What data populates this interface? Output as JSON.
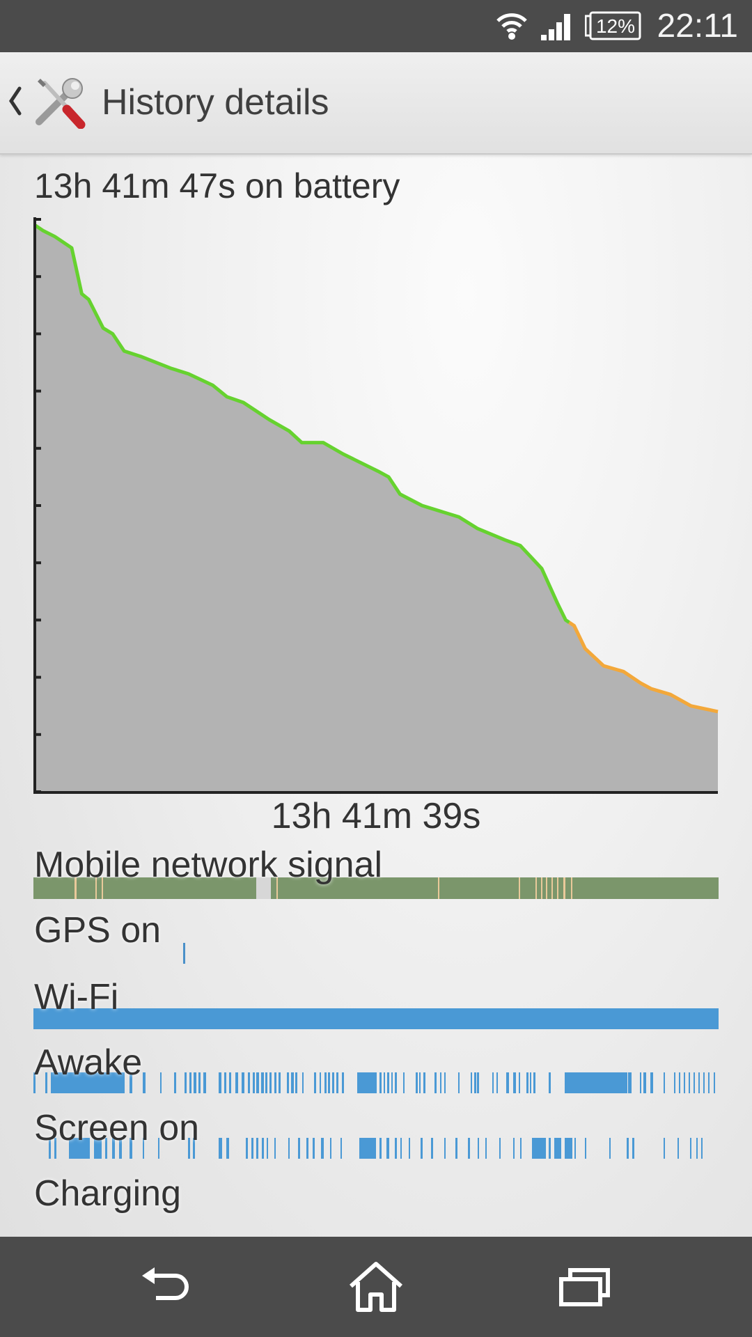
{
  "status_bar": {
    "battery_percent": "12%",
    "time": "22:11"
  },
  "header": {
    "title": "History details"
  },
  "summary": {
    "on_battery": "13h 41m 47s on battery",
    "x_axis_label": "13h 41m 39s"
  },
  "chart_data": {
    "type": "area",
    "title": "",
    "xlabel": "13h 41m 39s",
    "ylabel": "",
    "x_range_hours": [
      0,
      13.69
    ],
    "y_range_percent": [
      0,
      100
    ],
    "series": [
      {
        "x_hours": [
          0,
          0.17,
          0.4,
          0.74,
          0.94,
          1.08,
          1.37,
          1.56,
          1.79,
          2.14,
          2.72,
          3.08,
          3.57,
          3.85,
          4.18,
          4.7,
          5.1,
          5.35,
          5.78,
          6.18,
          6.88,
          7.09,
          7.32,
          7.76,
          8.5,
          8.87,
          9.42,
          9.73,
          10.16,
          10.47,
          10.64,
          10.81,
          11.03,
          11.4,
          11.8,
          12.14,
          12.35,
          12.74,
          13.15,
          13.69
        ],
        "level_percent": [
          99,
          98,
          97,
          95,
          87,
          86,
          81,
          80,
          77,
          76,
          74,
          73,
          71,
          69,
          68,
          65,
          63,
          61,
          61,
          59,
          56,
          55,
          52,
          50,
          48,
          46,
          44,
          43,
          39,
          33,
          30,
          29,
          25,
          22,
          21,
          19,
          18,
          17,
          15,
          14
        ],
        "line_color_segments": [
          {
            "to_hours": 10.71,
            "color": "#66d22f"
          },
          {
            "to_hours": 13.69,
            "color": "#f3a83a"
          }
        ]
      }
    ],
    "fill_color": "#b3b3b3",
    "grid": false
  },
  "rows": [
    {
      "label": "Mobile network signal",
      "key": "signal"
    },
    {
      "label": "GPS on",
      "key": "gps"
    },
    {
      "label": "Wi-Fi",
      "key": "wifi"
    },
    {
      "label": "Awake",
      "key": "awake"
    },
    {
      "label": "Screen on",
      "key": "screen"
    },
    {
      "label": "Charging",
      "key": "charging"
    }
  ],
  "bars": {
    "signal": {
      "color": "#7b966b",
      "gaps": [
        [
          0.06,
          0.003
        ],
        [
          0.09,
          0.003
        ],
        [
          0.1,
          0.002
        ],
        [
          0.325,
          0.022
        ],
        [
          0.355,
          0.002
        ],
        [
          0.59,
          0.002
        ],
        [
          0.708,
          0.002
        ],
        [
          0.733,
          0.002
        ],
        [
          0.741,
          0.002
        ],
        [
          0.748,
          0.002
        ],
        [
          0.756,
          0.002
        ],
        [
          0.764,
          0.002
        ],
        [
          0.773,
          0.003
        ],
        [
          0.785,
          0.002
        ]
      ],
      "gap_colors": [
        "#e9c99a",
        "#d7d7d7"
      ]
    },
    "gps": {
      "color": "#4a90c9",
      "spans": [
        [
          0.219,
          0.003
        ]
      ]
    },
    "wifi": {
      "color": "#4a99d5",
      "spans": [
        [
          0,
          1
        ]
      ]
    },
    "awake": {
      "color": "#4a99d5",
      "spans": [
        [
          0.0,
          0.003
        ],
        [
          0.017,
          0.003
        ],
        [
          0.025,
          0.108
        ],
        [
          0.14,
          0.004
        ],
        [
          0.16,
          0.004
        ],
        [
          0.185,
          0.002
        ],
        [
          0.205,
          0.003
        ],
        [
          0.221,
          0.003
        ],
        [
          0.228,
          0.003
        ],
        [
          0.234,
          0.004
        ],
        [
          0.241,
          0.003
        ],
        [
          0.248,
          0.004
        ],
        [
          0.27,
          0.004
        ],
        [
          0.278,
          0.004
        ],
        [
          0.286,
          0.003
        ],
        [
          0.295,
          0.004
        ],
        [
          0.304,
          0.004
        ],
        [
          0.313,
          0.003
        ],
        [
          0.32,
          0.003
        ],
        [
          0.325,
          0.004
        ],
        [
          0.332,
          0.004
        ],
        [
          0.338,
          0.003
        ],
        [
          0.345,
          0.003
        ],
        [
          0.352,
          0.003
        ],
        [
          0.358,
          0.003
        ],
        [
          0.37,
          0.003
        ],
        [
          0.376,
          0.004
        ],
        [
          0.382,
          0.003
        ],
        [
          0.392,
          0.002
        ],
        [
          0.41,
          0.003
        ],
        [
          0.418,
          0.002
        ],
        [
          0.425,
          0.003
        ],
        [
          0.43,
          0.003
        ],
        [
          0.436,
          0.003
        ],
        [
          0.442,
          0.003
        ],
        [
          0.45,
          0.003
        ],
        [
          0.473,
          0.028
        ],
        [
          0.505,
          0.003
        ],
        [
          0.511,
          0.002
        ],
        [
          0.516,
          0.003
        ],
        [
          0.522,
          0.002
        ],
        [
          0.527,
          0.003
        ],
        [
          0.54,
          0.002
        ],
        [
          0.558,
          0.003
        ],
        [
          0.563,
          0.002
        ],
        [
          0.569,
          0.003
        ],
        [
          0.585,
          0.003
        ],
        [
          0.593,
          0.003
        ],
        [
          0.6,
          0.002
        ],
        [
          0.62,
          0.002
        ],
        [
          0.638,
          0.002
        ],
        [
          0.643,
          0.003
        ],
        [
          0.647,
          0.003
        ],
        [
          0.67,
          0.002
        ],
        [
          0.676,
          0.002
        ],
        [
          0.69,
          0.004
        ],
        [
          0.7,
          0.004
        ],
        [
          0.708,
          0.002
        ],
        [
          0.72,
          0.003
        ],
        [
          0.725,
          0.002
        ],
        [
          0.73,
          0.003
        ],
        [
          0.752,
          0.003
        ],
        [
          0.775,
          0.092
        ],
        [
          0.87,
          0.003
        ],
        [
          0.868,
          0.002
        ],
        [
          0.885,
          0.002
        ],
        [
          0.89,
          0.004
        ],
        [
          0.9,
          0.004
        ],
        [
          0.92,
          0.002
        ],
        [
          0.935,
          0.002
        ],
        [
          0.942,
          0.002
        ],
        [
          0.949,
          0.002
        ],
        [
          0.956,
          0.002
        ],
        [
          0.963,
          0.002
        ],
        [
          0.971,
          0.002
        ],
        [
          0.978,
          0.002
        ],
        [
          0.985,
          0.002
        ],
        [
          0.993,
          0.002
        ]
      ]
    },
    "screen": {
      "color": "#4a99d5",
      "spans": [
        [
          0.022,
          0.003
        ],
        [
          0.03,
          0.004
        ],
        [
          0.052,
          0.03
        ],
        [
          0.088,
          0.012
        ],
        [
          0.105,
          0.003
        ],
        [
          0.115,
          0.004
        ],
        [
          0.125,
          0.004
        ],
        [
          0.14,
          0.004
        ],
        [
          0.16,
          0.002
        ],
        [
          0.182,
          0.002
        ],
        [
          0.226,
          0.003
        ],
        [
          0.233,
          0.003
        ],
        [
          0.27,
          0.005
        ],
        [
          0.282,
          0.004
        ],
        [
          0.31,
          0.003
        ],
        [
          0.318,
          0.003
        ],
        [
          0.325,
          0.003
        ],
        [
          0.333,
          0.003
        ],
        [
          0.34,
          0.003
        ],
        [
          0.352,
          0.002
        ],
        [
          0.372,
          0.002
        ],
        [
          0.386,
          0.003
        ],
        [
          0.398,
          0.003
        ],
        [
          0.408,
          0.003
        ],
        [
          0.42,
          0.004
        ],
        [
          0.433,
          0.002
        ],
        [
          0.448,
          0.002
        ],
        [
          0.476,
          0.024
        ],
        [
          0.505,
          0.003
        ],
        [
          0.515,
          0.004
        ],
        [
          0.527,
          0.003
        ],
        [
          0.536,
          0.002
        ],
        [
          0.548,
          0.002
        ],
        [
          0.565,
          0.003
        ],
        [
          0.58,
          0.003
        ],
        [
          0.6,
          0.002
        ],
        [
          0.616,
          0.003
        ],
        [
          0.634,
          0.003
        ],
        [
          0.648,
          0.002
        ],
        [
          0.66,
          0.002
        ],
        [
          0.68,
          0.002
        ],
        [
          0.7,
          0.002
        ],
        [
          0.71,
          0.002
        ],
        [
          0.728,
          0.02
        ],
        [
          0.752,
          0.003
        ],
        [
          0.76,
          0.01
        ],
        [
          0.775,
          0.012
        ],
        [
          0.79,
          0.002
        ],
        [
          0.805,
          0.002
        ],
        [
          0.84,
          0.002
        ],
        [
          0.866,
          0.003
        ],
        [
          0.874,
          0.003
        ],
        [
          0.92,
          0.002
        ],
        [
          0.94,
          0.002
        ],
        [
          0.958,
          0.002
        ],
        [
          0.967,
          0.002
        ],
        [
          0.975,
          0.002
        ]
      ]
    },
    "charging": {
      "color": "#4a99d5",
      "spans": []
    }
  },
  "icons": {
    "wifi": "wifi-icon",
    "signal": "cell-signal-icon",
    "battery": "battery-icon",
    "back": "back-arrow-icon",
    "home": "home-icon",
    "recents": "recent-apps-icon",
    "app": "tools-icon",
    "up": "chevron-left-icon"
  }
}
